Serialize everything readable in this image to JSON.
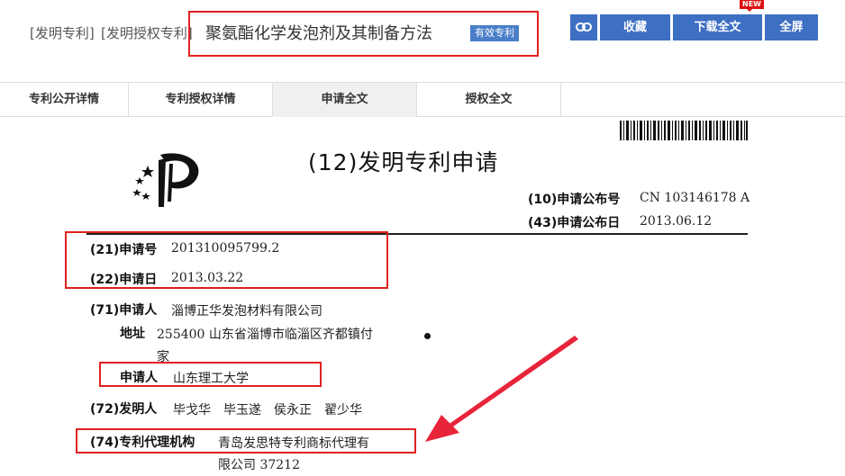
{
  "header": {
    "tag1": "[发明专利]",
    "tag2": "[发明授权专利]",
    "title": "聚氨酯化学发泡剂及其制备方法",
    "badge": "有效专利",
    "buttons": {
      "favorite": "收藏",
      "download": "下载全文",
      "fullscreen": "全屏"
    },
    "new_badge": "NEW",
    "link_icon": "link-icon"
  },
  "tabs": [
    {
      "label": "专利公开详情"
    },
    {
      "label": "专利授权详情"
    },
    {
      "label": "申请全文"
    },
    {
      "label": "授权全文"
    }
  ],
  "document": {
    "title": "(12)发明专利申请",
    "pub_no_label": "(10)申请公布号",
    "pub_no_value": "CN 103146178 A",
    "pub_date_label": "(43)申请公布日",
    "pub_date_value": "2013.06.12",
    "app_no_label": "(21)申请号",
    "app_no_value": "201310095799.2",
    "app_date_label": "(22)申请日",
    "app_date_value": "2013.03.22",
    "applicant_label": "(71)申请人",
    "applicant_value": "淄博正华发泡材料有限公司",
    "address_label": "地址",
    "address_line1": "255400 山东省淄博市临淄区齐都镇付",
    "address_line2": "家",
    "applicant2_label": "申请人",
    "applicant2_value": "山东理工大学",
    "inventor_label": "(72)发明人",
    "inventor_value": "毕戈华　毕玉遂　侯永正　翟少华",
    "agency_label": "(74)专利代理机构",
    "agency_line1": "青岛发思特专利商标代理有",
    "agency_line2": "限公司 37212"
  },
  "colors": {
    "accent": "#3d6fc3",
    "highlight": "#e02020"
  }
}
